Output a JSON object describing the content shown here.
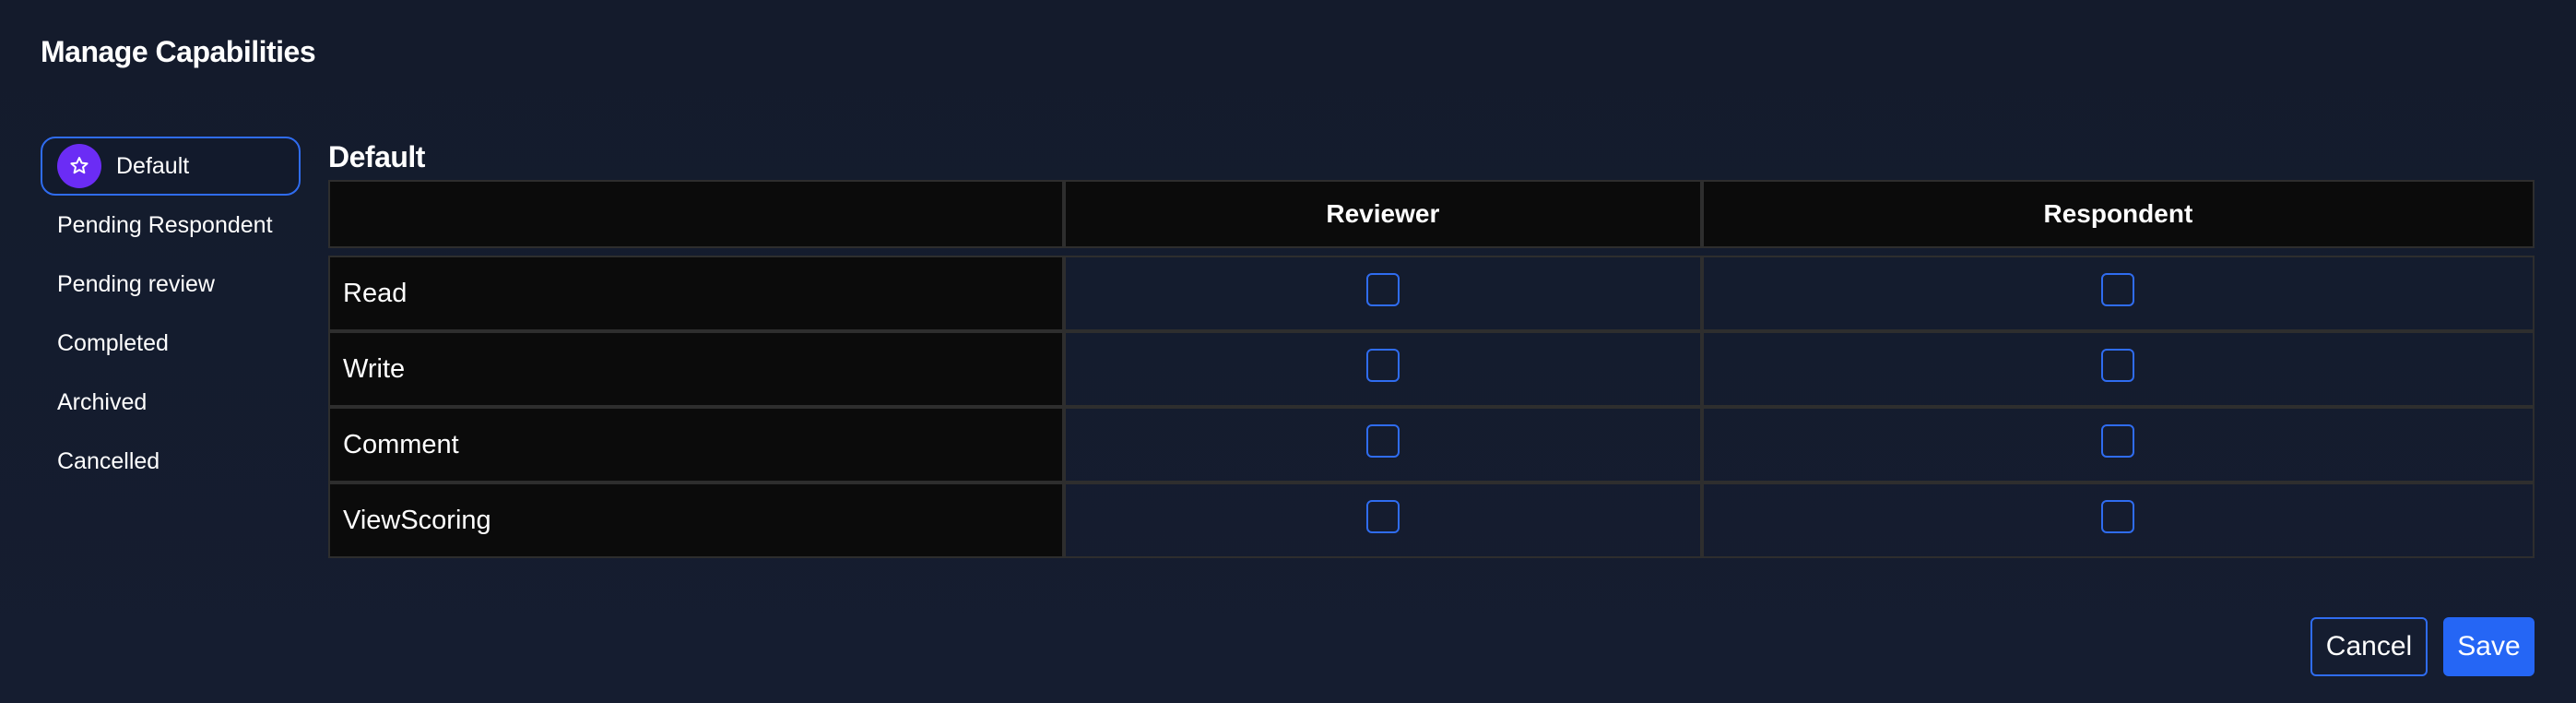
{
  "dialog": {
    "title": "Manage Capabilities"
  },
  "sidebar": {
    "items": [
      {
        "label": "Default",
        "active": true,
        "icon": "star-icon"
      },
      {
        "label": "Pending Respondent",
        "active": false
      },
      {
        "label": "Pending review",
        "active": false
      },
      {
        "label": "Completed",
        "active": false
      },
      {
        "label": "Archived",
        "active": false
      },
      {
        "label": "Cancelled",
        "active": false
      }
    ]
  },
  "main": {
    "section_title": "Default",
    "table": {
      "columns": [
        "",
        "Reviewer",
        "Respondent"
      ],
      "rows": [
        {
          "label": "Read",
          "reviewer": false,
          "respondent": false
        },
        {
          "label": "Write",
          "reviewer": false,
          "respondent": false
        },
        {
          "label": "Comment",
          "reviewer": false,
          "respondent": false
        },
        {
          "label": "ViewScoring",
          "reviewer": false,
          "respondent": false
        }
      ]
    }
  },
  "footer": {
    "cancel_label": "Cancel",
    "save_label": "Save"
  },
  "colors": {
    "background": "#141b2d",
    "accent": "#2f6cf0",
    "badge": "#6b2cf5",
    "table_cell": "#0b0b0b"
  }
}
